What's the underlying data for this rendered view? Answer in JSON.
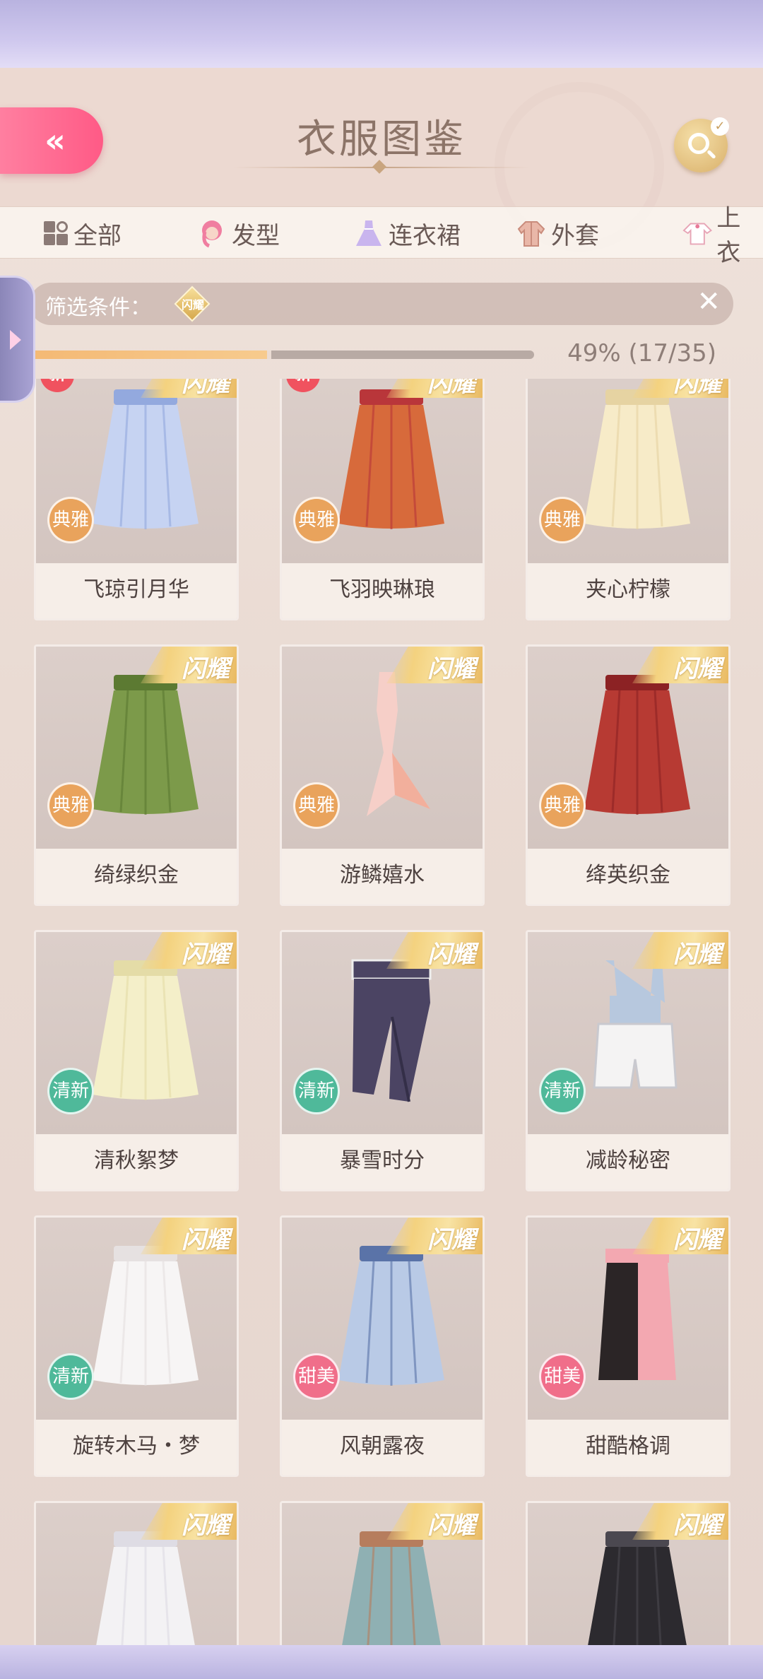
{
  "header": {
    "title": "衣服图鉴",
    "back_label": "«"
  },
  "tabs": [
    {
      "label": "全部",
      "icon": "grid-icon"
    },
    {
      "label": "发型",
      "icon": "hair-icon"
    },
    {
      "label": "连衣裙",
      "icon": "dress-icon"
    },
    {
      "label": "外套",
      "icon": "coat-icon"
    },
    {
      "label": "上衣",
      "icon": "shirt-icon"
    }
  ],
  "filter": {
    "label": "筛选条件：",
    "chip": "闪耀",
    "close": "✕"
  },
  "progress": {
    "text": "49% (17/35)",
    "fraction": 0.49
  },
  "colors": {
    "accent_pink": "#ff5a86",
    "gold": "#f4d27f",
    "elegant": "#e9a35c",
    "fresh": "#4fb99a",
    "sweet": "#f06e8a"
  },
  "items": [
    {
      "name": "飞琼引月华",
      "style": "典雅",
      "shine": "闪耀",
      "new": "新",
      "garment": "skirt-blue"
    },
    {
      "name": "飞羽映琳琅",
      "style": "典雅",
      "shine": "闪耀",
      "new": "新",
      "garment": "skirt-red-gold"
    },
    {
      "name": "夹心柠檬",
      "style": "典雅",
      "shine": "闪耀",
      "new": "",
      "garment": "skirt-cream"
    },
    {
      "name": "绮绿织金",
      "style": "典雅",
      "shine": "闪耀",
      "new": "",
      "garment": "skirt-green"
    },
    {
      "name": "游鳞嬉水",
      "style": "典雅",
      "shine": "闪耀",
      "new": "",
      "garment": "mermaid-pink"
    },
    {
      "name": "绛英织金",
      "style": "典雅",
      "shine": "闪耀",
      "new": "",
      "garment": "skirt-crimson"
    },
    {
      "name": "清秋絮梦",
      "style": "清新",
      "shine": "闪耀",
      "new": "",
      "garment": "skirt-ivory"
    },
    {
      "name": "暴雪时分",
      "style": "清新",
      "shine": "闪耀",
      "new": "",
      "garment": "pants-navy"
    },
    {
      "name": "减龄秘密",
      "style": "清新",
      "shine": "闪耀",
      "new": "",
      "garment": "overalls-white"
    },
    {
      "name": "旋转木马・梦",
      "style": "清新",
      "shine": "闪耀",
      "new": "",
      "garment": "skirt-white"
    },
    {
      "name": "风朝露夜",
      "style": "甜美",
      "shine": "闪耀",
      "new": "",
      "garment": "skirt-lightblue"
    },
    {
      "name": "甜酷格调",
      "style": "甜美",
      "shine": "闪耀",
      "new": "",
      "garment": "skirt-black-pink"
    },
    {
      "name": "",
      "style": "",
      "shine": "闪耀",
      "new": "",
      "garment": "skirt-white-2"
    },
    {
      "name": "",
      "style": "",
      "shine": "闪耀",
      "new": "",
      "garment": "skirt-plaid"
    },
    {
      "name": "",
      "style": "",
      "shine": "闪耀",
      "new": "",
      "garment": "skirt-black-sequin"
    }
  ]
}
